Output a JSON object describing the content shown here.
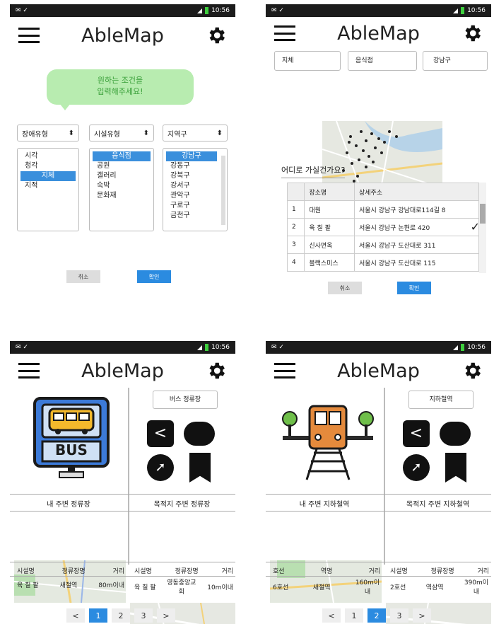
{
  "status": {
    "time": "10:56"
  },
  "app_title": "AbleMap",
  "p1": {
    "bubble_line1": "원하는 조건을",
    "bubble_line2": "입력해주세요!",
    "sel1": "장애유형",
    "sel2": "시설유형",
    "sel3": "지역구",
    "list1": [
      "시각",
      "청각",
      "지체",
      "지적"
    ],
    "list2": [
      "음식점",
      "공원",
      "갤러리",
      "숙박",
      "문화재"
    ],
    "list3": [
      "강남구",
      "강동구",
      "강북구",
      "강서구",
      "관악구",
      "구로구",
      "금천구"
    ],
    "cancel": "취소",
    "confirm": "확인"
  },
  "p2": {
    "filter1": "지체",
    "filter2": "음식점",
    "filter3": "강남구",
    "question": "어디로 가실건가요?",
    "col_name": "장소명",
    "col_addr": "상세주소",
    "rows": [
      {
        "n": "1",
        "name": "대원",
        "addr": "서울시 강남구 강남대로114길 8"
      },
      {
        "n": "2",
        "name": "육 칠 팔",
        "addr": "서울시 강남구 논현로 420"
      },
      {
        "n": "3",
        "name": "신사면옥",
        "addr": "서울시 강남구 도산대로 311"
      },
      {
        "n": "4",
        "name": "블랙스미스",
        "addr": "서울시 강남구 도산대로 115"
      }
    ],
    "cancel": "취소",
    "confirm": "확인"
  },
  "p3": {
    "type_label": "버스 정류장",
    "bus_sign": "BUS",
    "near_label": "내 주변 정류장",
    "dest_label": "목적지 주변 정류장",
    "left_headers": [
      "시설명",
      "정류장명",
      "거리"
    ],
    "left_row": [
      "육 칠 팔",
      "새절역",
      "80m이내"
    ],
    "right_headers": [
      "시설명",
      "정류장명",
      "거리"
    ],
    "right_row": [
      "육 칠 팔",
      "영동중앙교회",
      "10m이내"
    ],
    "pages": [
      "<",
      "1",
      "2",
      "3",
      ">"
    ]
  },
  "p4": {
    "type_label": "지하철역",
    "near_label": "내 주변 지하철역",
    "dest_label": "목적지 주변 지하철역",
    "left_headers": [
      "호선",
      "역명",
      "거리"
    ],
    "left_row": [
      "6호선",
      "새절역",
      "160m이내"
    ],
    "right_headers": [
      "시설명",
      "정류장명",
      "거리"
    ],
    "right_row": [
      "2호선",
      "역삼역",
      "390m이내"
    ],
    "pages": [
      "<",
      "1",
      "2",
      "3",
      ">"
    ]
  }
}
